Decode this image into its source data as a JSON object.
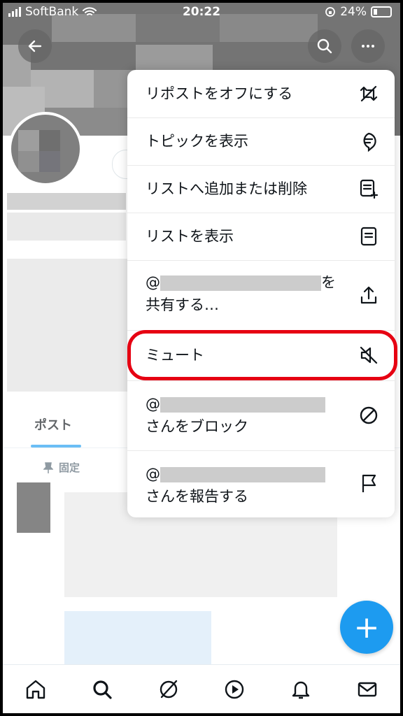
{
  "status_bar": {
    "carrier": "SoftBank",
    "time": "20:22",
    "battery": "24%"
  },
  "profile": {
    "tab_posts": "ポスト",
    "pinned_label": "固定"
  },
  "menu": {
    "items": [
      {
        "label": "リポストをオフにする",
        "icon": "repost-off-icon"
      },
      {
        "label": "トピックを表示",
        "icon": "topic-icon"
      },
      {
        "label": "リストへ追加または削除",
        "icon": "list-add-icon"
      },
      {
        "label": "リストを表示",
        "icon": "list-icon"
      },
      {
        "line1_prefix": "@",
        "line1_suffix": "を",
        "line2": "共有する…",
        "icon": "share-icon"
      },
      {
        "label": "ミュート",
        "icon": "mute-icon"
      },
      {
        "line1_prefix": "@",
        "line2": "さんをブロック",
        "icon": "block-icon"
      },
      {
        "line1_prefix": "@",
        "line2": "さんを報告する",
        "icon": "flag-icon"
      }
    ]
  },
  "fab": {
    "label": "+"
  },
  "colors": {
    "accent": "#1d9bf0",
    "highlight": "#e60012"
  }
}
